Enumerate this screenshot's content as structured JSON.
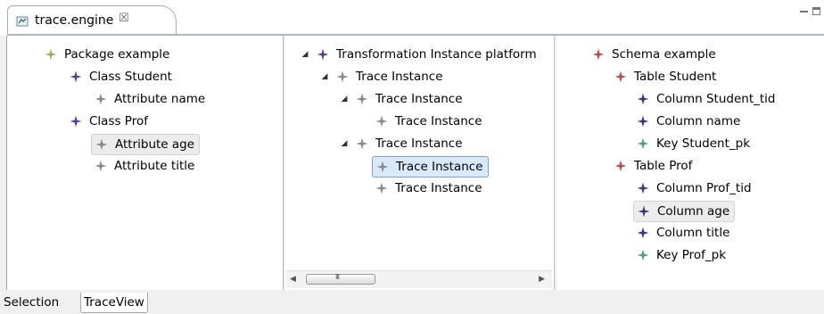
{
  "editor_tab": {
    "title": "trace.engine",
    "close": "☒"
  },
  "left_tree": [
    {
      "label": "Package example",
      "level": 0,
      "icon": "olive"
    },
    {
      "label": "Class Student",
      "level": 1,
      "icon": "purple"
    },
    {
      "label": "Attribute name",
      "level": 2,
      "icon": "gray"
    },
    {
      "label": "Class Prof",
      "level": 1,
      "icon": "purple"
    },
    {
      "label": "Attribute age",
      "level": 2,
      "icon": "gray",
      "selected": true
    },
    {
      "label": "Attribute title",
      "level": 2,
      "icon": "gray"
    }
  ],
  "middle_tree": [
    {
      "label": "Transformation Instance platform",
      "level": 0,
      "icon": "purple",
      "expanded": true
    },
    {
      "label": "Trace Instance",
      "level": 1,
      "icon": "gray",
      "expanded": true
    },
    {
      "label": "Trace Instance",
      "level": 2,
      "icon": "gray",
      "expanded": true
    },
    {
      "label": "Trace Instance",
      "level": 3,
      "icon": "gray"
    },
    {
      "label": "Trace Instance",
      "level": 2,
      "icon": "gray",
      "expanded": true
    },
    {
      "label": "Trace Instance",
      "level": 3,
      "icon": "gray",
      "selected": true
    },
    {
      "label": "Trace Instance",
      "level": 3,
      "icon": "gray"
    }
  ],
  "right_tree": [
    {
      "label": "Schema example",
      "level": 0,
      "icon": "red"
    },
    {
      "label": "Table Student",
      "level": 1,
      "icon": "red"
    },
    {
      "label": "Column Student_tid",
      "level": 2,
      "icon": "blue"
    },
    {
      "label": "Column name",
      "level": 2,
      "icon": "blue"
    },
    {
      "label": "Key Student_pk",
      "level": 2,
      "icon": "green"
    },
    {
      "label": "Table Prof",
      "level": 1,
      "icon": "red"
    },
    {
      "label": "Column Prof_tid",
      "level": 2,
      "icon": "blue"
    },
    {
      "label": "Column age",
      "level": 2,
      "icon": "blue",
      "selected": true
    },
    {
      "label": "Column title",
      "level": 2,
      "icon": "blue"
    },
    {
      "label": "Key Prof_pk",
      "level": 2,
      "icon": "green"
    }
  ],
  "scrollbar": {
    "grip": "III"
  },
  "bottom_tabs": {
    "selection": "Selection",
    "traceview": "TraceView"
  },
  "colors": {
    "olive": "#a8a85a",
    "purple": "#5c3d8f",
    "gray": "#8a8a8a",
    "red": "#c64545",
    "blue": "#38387e",
    "green": "#4aa07a"
  }
}
